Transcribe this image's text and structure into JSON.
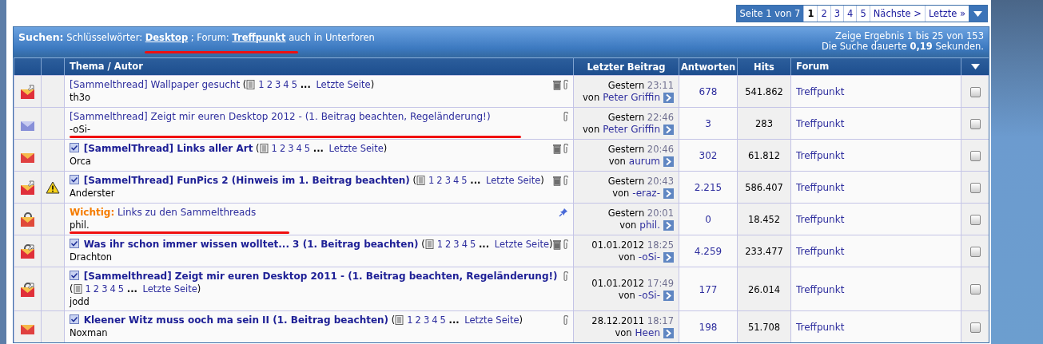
{
  "pagination": {
    "label": "Seite 1 von 7",
    "pages": [
      {
        "label": "1",
        "selected": true
      },
      {
        "label": "2",
        "selected": false
      },
      {
        "label": "3",
        "selected": false
      },
      {
        "label": "4",
        "selected": false
      },
      {
        "label": "5",
        "selected": false
      }
    ],
    "next": "Nächste >",
    "last": "Letzte »"
  },
  "search": {
    "title": "Suchen:",
    "keywords_label": "Schlüsselwörter:",
    "keywords": "Desktop",
    "separator": "; Forum:",
    "forum": "Treffpunkt",
    "scope": "auch in Unterforen",
    "marked": true,
    "results": "Zeige Ergebnis 1 bis 25 von 153",
    "duration": "Die Suche dauerte **0,19** Sekunden."
  },
  "columns": [
    "Thema / Autor",
    "Letzter Beitrag",
    "Antworten",
    "Hits",
    "Forum"
  ],
  "rows": [
    {
      "kind": "hot-new",
      "warning": false,
      "subscribed": false,
      "bold": false,
      "title": "[Sammelthread] Wallpaper gesucht",
      "page_links": {
        "open": "(",
        "pages": [
          "1",
          "2",
          "3",
          "4",
          "5"
        ],
        "ellipsis": "...",
        "last": "Letzte Seite",
        "close": ")"
      },
      "trash": true,
      "clip": true,
      "pin": false,
      "marked": false,
      "author": "th3o",
      "date": "Gestern",
      "time": "23:11",
      "by_label": "von",
      "by": "Peter Griffin",
      "replies": "678",
      "hits": "541.862",
      "forum": "Treffpunkt"
    },
    {
      "kind": "read",
      "warning": false,
      "subscribed": false,
      "bold": false,
      "title": "[Sammelthread] Zeigt mir euren Desktop 2012 - (1. Beitrag beachten, Regeländerung!)",
      "trash": false,
      "clip": true,
      "pin": false,
      "marked": true,
      "author": "-oSi-",
      "date": "Gestern",
      "time": "22:46",
      "by_label": "von",
      "by": "Peter Griffin",
      "replies": "3",
      "hits": "283",
      "forum": "Treffpunkt"
    },
    {
      "kind": "hot",
      "warning": false,
      "subscribed": true,
      "bold": true,
      "title": "[SammelThread] Links aller Art",
      "page_links": {
        "open": "(",
        "pages": [
          "1",
          "2",
          "3",
          "4",
          "5"
        ],
        "ellipsis": "...",
        "last": "Letzte Seite",
        "close": ")"
      },
      "trash": true,
      "clip": true,
      "pin": false,
      "marked": false,
      "author": "Orca",
      "date": "Gestern",
      "time": "20:46",
      "by_label": "von",
      "by": "aurum",
      "replies": "302",
      "hits": "61.812",
      "forum": "Treffpunkt"
    },
    {
      "kind": "hot-new",
      "warning": true,
      "subscribed": true,
      "bold": true,
      "title": "[SammelThread] FunPics 2 (Hinweis im 1. Beitrag beachten)",
      "page_links": {
        "open": "(",
        "pages": [
          "1",
          "2",
          "3",
          "4",
          "5"
        ],
        "ellipsis": "...",
        "last": "Letzte Seite",
        "close": ")"
      },
      "trash": true,
      "clip": true,
      "pin": false,
      "marked": false,
      "author": "Anderster",
      "date": "Gestern",
      "time": "20:43",
      "by_label": "von",
      "by": "-eraz-",
      "replies": "2.215",
      "hits": "586.407",
      "forum": "Treffpunkt"
    },
    {
      "kind": "locked",
      "warning": false,
      "subscribed": false,
      "bold": false,
      "prefix": "Wichtig:",
      "title": "Links zu den Sammelthreads",
      "trash": false,
      "clip": false,
      "pin": true,
      "marked": true,
      "author": "phil.",
      "date": "Gestern",
      "time": "20:01",
      "by_label": "von",
      "by": "phil.",
      "replies": "0",
      "hits": "18.452",
      "forum": "Treffpunkt"
    },
    {
      "kind": "hot-locked",
      "warning": false,
      "subscribed": true,
      "bold": true,
      "title": "Was ihr schon immer wissen wolltet... 3 (1. Beitrag beachten)",
      "page_links": {
        "open": "(",
        "pages": [
          "1",
          "2",
          "3",
          "4",
          "5"
        ],
        "ellipsis": "...",
        "last": "Letzte Seite",
        "close": ")"
      },
      "trash": true,
      "clip": true,
      "pin": false,
      "marked": false,
      "author": "Drachton",
      "date": "01.01.2012",
      "time": "18:25",
      "by_label": "von",
      "by": "-oSi-",
      "replies": "4.259",
      "hits": "233.477",
      "forum": "Treffpunkt"
    },
    {
      "kind": "hot-locked",
      "warning": false,
      "subscribed": true,
      "bold": true,
      "title": "[Sammelthread] Zeigt mir euren Desktop 2011 - (1. Beitrag beachten, Regeländerung!)",
      "wrapped_page_links": {
        "open": "(",
        "pages": [
          "1",
          "2",
          "3",
          "4",
          "5"
        ],
        "ellipsis": "...",
        "last": "Letzte Seite",
        "close": ")"
      },
      "trash": false,
      "clip": true,
      "pin": false,
      "marked": false,
      "author": "jodd",
      "date": "01.01.2012",
      "time": "17:49",
      "by_label": "von",
      "by": "-oSi-",
      "replies": "177",
      "hits": "26.014",
      "forum": "Treffpunkt"
    },
    {
      "kind": "hot",
      "warning": false,
      "subscribed": true,
      "bold": true,
      "title": "Kleener Witz muss ooch ma sein II (1. Beitrag beachten)",
      "page_links": {
        "open": "(",
        "pages": [
          "1",
          "2",
          "3",
          "4",
          "5"
        ],
        "ellipsis": "...",
        "last": "Letzte Seite",
        "close": ")"
      },
      "trash": false,
      "clip": true,
      "pin": false,
      "marked": false,
      "author": "Noxman",
      "date": "28.12.2011",
      "time": "18:17",
      "by_label": "von",
      "by": "Heen",
      "replies": "198",
      "hits": "51.708",
      "forum": "Treffpunkt"
    }
  ]
}
